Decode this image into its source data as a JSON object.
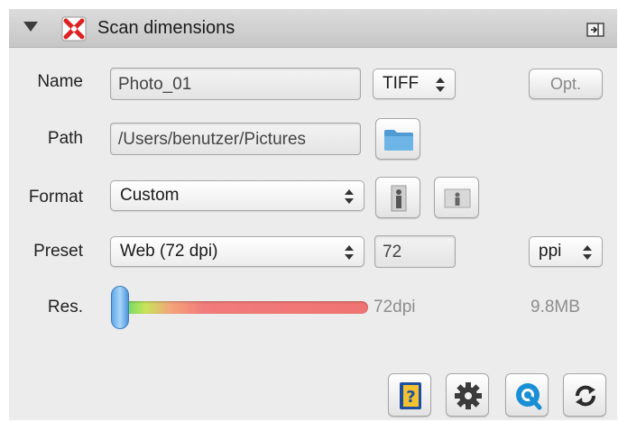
{
  "panel": {
    "title": "Scan dimensions"
  },
  "rows": {
    "name": {
      "label": "Name",
      "value": "Photo_01",
      "format": "TIFF",
      "options_button": "Opt."
    },
    "path": {
      "label": "Path",
      "value": "/Users/benutzer/Pictures"
    },
    "format": {
      "label": "Format",
      "value": "Custom"
    },
    "preset": {
      "label": "Preset",
      "value": "Web (72 dpi)",
      "resolution_value": "72",
      "unit": "ppi"
    },
    "res": {
      "label": "Res.",
      "slider_fraction": 0.0,
      "resolution_text": "72dpi",
      "file_size": "9.8MB"
    }
  },
  "colors": {
    "panel_bg": "#ececec",
    "folder_blue": "#5aa6dc",
    "slider_green": "#3fd66a",
    "slider_red": "#f07373",
    "knob_blue": "#5fa8e6"
  },
  "icons": {
    "disclosure": "disclosure-triangle-icon",
    "app": "scanner-app-icon",
    "detach": "detach-panel-icon",
    "folder": "folder-icon",
    "portrait": "portrait-orientation-icon",
    "landscape": "landscape-orientation-icon",
    "help": "help-book-icon",
    "settings": "gear-icon",
    "quickscan": "quick-scan-icon",
    "reset": "reset-icon"
  }
}
